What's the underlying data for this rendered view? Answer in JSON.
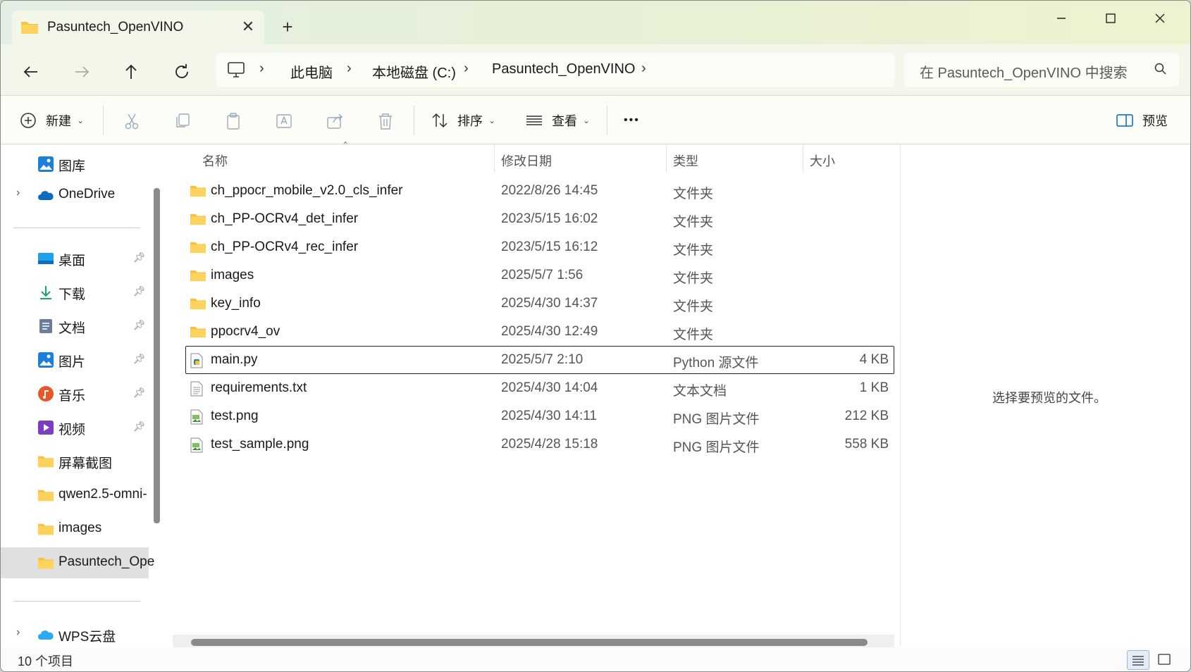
{
  "window": {
    "tab_title": "Pasuntech_OpenVINO",
    "new_tab_label": "+",
    "close_tab_label": "✕"
  },
  "address": {
    "crumbs": [
      "此电脑",
      "本地磁盘 (C:)",
      "Pasuntech_OpenVINO"
    ]
  },
  "search": {
    "placeholder": "在 Pasuntech_OpenVINO 中搜索"
  },
  "toolbar": {
    "new_label": "新建",
    "sort_label": "排序",
    "view_label": "查看",
    "more_label": "•••",
    "preview_label": "预览"
  },
  "sidebar": {
    "items": [
      {
        "label": "图库",
        "icon": "gallery-icon"
      },
      {
        "label": "OneDrive",
        "icon": "onedrive-icon"
      },
      {
        "label": "桌面",
        "icon": "desktop-icon",
        "pinned": true
      },
      {
        "label": "下载",
        "icon": "download-icon",
        "pinned": true
      },
      {
        "label": "文档",
        "icon": "document-icon",
        "pinned": true
      },
      {
        "label": "图片",
        "icon": "pictures-icon",
        "pinned": true
      },
      {
        "label": "音乐",
        "icon": "music-icon",
        "pinned": true
      },
      {
        "label": "视频",
        "icon": "video-icon",
        "pinned": true
      },
      {
        "label": "屏幕截图",
        "icon": "folder-icon"
      },
      {
        "label": "qwen2.5-omni-",
        "icon": "folder-icon"
      },
      {
        "label": "images",
        "icon": "folder-icon"
      },
      {
        "label": "Pasuntech_Ope",
        "icon": "folder-icon",
        "selected": true
      },
      {
        "label": "WPS云盘",
        "icon": "wps-cloud-icon"
      }
    ]
  },
  "columns": {
    "name": "名称",
    "date": "修改日期",
    "type": "类型",
    "size": "大小"
  },
  "files": [
    {
      "name": "ch_ppocr_mobile_v2.0_cls_infer",
      "date": "2022/8/26 14:45",
      "type": "文件夹",
      "size": "",
      "icon": "folder-icon"
    },
    {
      "name": "ch_PP-OCRv4_det_infer",
      "date": "2023/5/15 16:02",
      "type": "文件夹",
      "size": "",
      "icon": "folder-icon"
    },
    {
      "name": "ch_PP-OCRv4_rec_infer",
      "date": "2023/5/15 16:12",
      "type": "文件夹",
      "size": "",
      "icon": "folder-icon"
    },
    {
      "name": "images",
      "date": "2025/5/7 1:56",
      "type": "文件夹",
      "size": "",
      "icon": "folder-icon"
    },
    {
      "name": "key_info",
      "date": "2025/4/30 14:37",
      "type": "文件夹",
      "size": "",
      "icon": "folder-icon"
    },
    {
      "name": "ppocrv4_ov",
      "date": "2025/4/30 12:49",
      "type": "文件夹",
      "size": "",
      "icon": "folder-icon"
    },
    {
      "name": "main.py",
      "date": "2025/5/7 2:10",
      "type": "Python 源文件",
      "size": "4 KB",
      "icon": "python-file-icon",
      "focused": true
    },
    {
      "name": "requirements.txt",
      "date": "2025/4/30 14:04",
      "type": "文本文档",
      "size": "1 KB",
      "icon": "text-file-icon"
    },
    {
      "name": "test.png",
      "date": "2025/4/30 14:11",
      "type": "PNG 图片文件",
      "size": "212 KB",
      "icon": "image-file-icon"
    },
    {
      "name": "test_sample.png",
      "date": "2025/4/28 15:18",
      "type": "PNG 图片文件",
      "size": "558 KB",
      "icon": "image-file-icon"
    }
  ],
  "preview": {
    "message": "选择要预览的文件。"
  },
  "status": {
    "item_count": "10 个项目"
  },
  "colors": {
    "folder": "#f5c242",
    "accent": "#0067c0"
  }
}
